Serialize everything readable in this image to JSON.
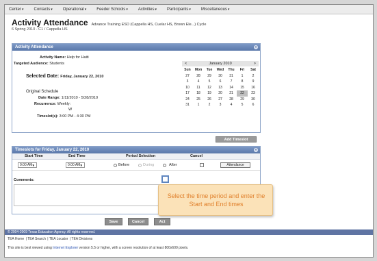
{
  "nav": {
    "items": [
      "Center",
      "Contacts",
      "Operational",
      "Feeder Schools",
      "Activities",
      "Participants",
      "Miscellaneous"
    ]
  },
  "header": {
    "title": "Activity Attendance",
    "subtitle": "Advance Training ESD (Cappella HS, Cuelar HS, Brown Ele...) Cycle",
    "subline": "6 Spring 2010 - C1 / Cappella HS"
  },
  "activity_panel": {
    "title": "Activity Attendance",
    "activity_name_label": "Activity Name:",
    "activity_name": "Help for Haiti",
    "audience_label": "Targeted Audience:",
    "audience": "Students",
    "selected_date_label": "Selected Date:",
    "selected_date": "Friday, January 22, 2010",
    "original_schedule_label": "Original Schedule",
    "date_range_label": "Date Range:",
    "date_range": "1/11/2010 - 5/28/2010",
    "recurrence_label": "Recurrence:",
    "recurrence": "Weekly:",
    "recurrence_day": "W",
    "timeslots_label": "Timeslot(s):",
    "timeslots": "3:00 PM - 4:30 PM"
  },
  "calendar": {
    "prev": "<",
    "next": ">",
    "month": "January 2010",
    "days_of_week": [
      "Sun",
      "Mon",
      "Tue",
      "Wed",
      "Thu",
      "Fri",
      "Sat"
    ],
    "weeks": [
      [
        "27",
        "28",
        "29",
        "30",
        "31",
        "1",
        "2"
      ],
      [
        "3",
        "4",
        "5",
        "6",
        "7",
        "8",
        "9"
      ],
      [
        "10",
        "11",
        "12",
        "13",
        "14",
        "15",
        "16"
      ],
      [
        "17",
        "18",
        "19",
        "20",
        "21",
        "22",
        "23"
      ],
      [
        "24",
        "25",
        "26",
        "27",
        "28",
        "29",
        "30"
      ],
      [
        "31",
        "1",
        "2",
        "3",
        "4",
        "5",
        "6"
      ]
    ],
    "selected_day": "22"
  },
  "add_timeslot_label": "Add Timeslot",
  "timeslots_panel": {
    "title": "Timeslots for Friday, January 22, 2010",
    "col_start": "Start Time",
    "col_end": "End Time",
    "col_period": "Period Selection",
    "col_cancel": "Cancel",
    "start_value": "0:00 AM",
    "end_value": "0:00 AM",
    "before_label": "Before",
    "during_label": "During",
    "after_label": "After",
    "attendance_label": "Attendance",
    "comments_label": "Comments:"
  },
  "buttons": {
    "save": "Save",
    "cancel": "Cancel",
    "third": "Act"
  },
  "callout": {
    "text": "Select the time period and enter the Start and End times"
  },
  "footer": {
    "copyright": "© 2004-2009 Texas Education Agency. All rights reserved.",
    "links": [
      "TEA Home",
      "TEA Search",
      "TEA Locator",
      "TEA Divisions"
    ],
    "note_pre": "This site is best viewed using",
    "note_link": "Internet Explorer",
    "note_post": "version 5.5 or higher, with a screen resolution of at least 800x600 pixels."
  },
  "colors": {
    "panel_header": "#5a78aa",
    "callout_bg": "#fbe2b8",
    "callout_text": "#e07f2a",
    "footer_bar": "#5f74a3"
  }
}
